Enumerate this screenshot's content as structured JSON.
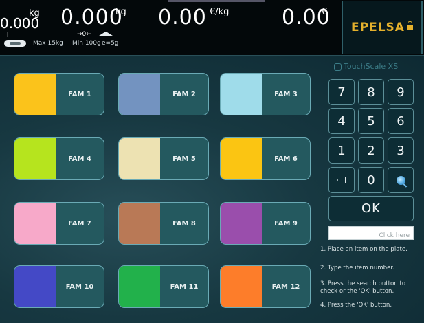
{
  "display": {
    "tare_unit": "kg",
    "tare_value": "0.000",
    "tare_label": "T",
    "weight_value": "0.000",
    "weight_unit": "kg",
    "price_value": "0.00",
    "price_unit": "€/kg",
    "total_value": "0.00",
    "total_unit": "€",
    "zero_symbol": "→0←",
    "spec_max": "Max 15kg",
    "spec_min": "Min 100g",
    "spec_e": "e=5g",
    "brand": "EPELSA",
    "brand_icon": "lock-icon"
  },
  "families": [
    {
      "label": "FAM 1",
      "color": "#fbc31b"
    },
    {
      "label": "FAM 2",
      "color": "#7393c0"
    },
    {
      "label": "FAM 3",
      "color": "#9fdcea"
    },
    {
      "label": "FAM 4",
      "color": "#b6e41e"
    },
    {
      "label": "FAM 5",
      "color": "#ede2b2"
    },
    {
      "label": "FAM 6",
      "color": "#fbc512"
    },
    {
      "label": "FAM 7",
      "color": "#f7a9c9"
    },
    {
      "label": "FAM 8",
      "color": "#b97956"
    },
    {
      "label": "FAM 9",
      "color": "#9a4eac"
    },
    {
      "label": "FAM 10",
      "color": "#4449c6"
    },
    {
      "label": "FAM 11",
      "color": "#22b14b"
    },
    {
      "label": "FAM 12",
      "color": "#fd7d2a"
    }
  ],
  "keypad": {
    "logo": "TouchScale XS",
    "logo_icon": "touchscale-icon",
    "keys": [
      "7",
      "8",
      "9",
      "4",
      "5",
      "6",
      "1",
      "2",
      "3"
    ],
    "zero": "0",
    "backspace_icon": "backspace-icon",
    "search_icon": "search-icon",
    "ok": "OK",
    "input_placeholder": "Click here",
    "input_value": ""
  },
  "instructions": [
    "1. Place an item on the plate.",
    "2. Type the item number.",
    "3. Press the search button to check or the 'OK' button.",
    "4. Press the 'OK' button."
  ]
}
